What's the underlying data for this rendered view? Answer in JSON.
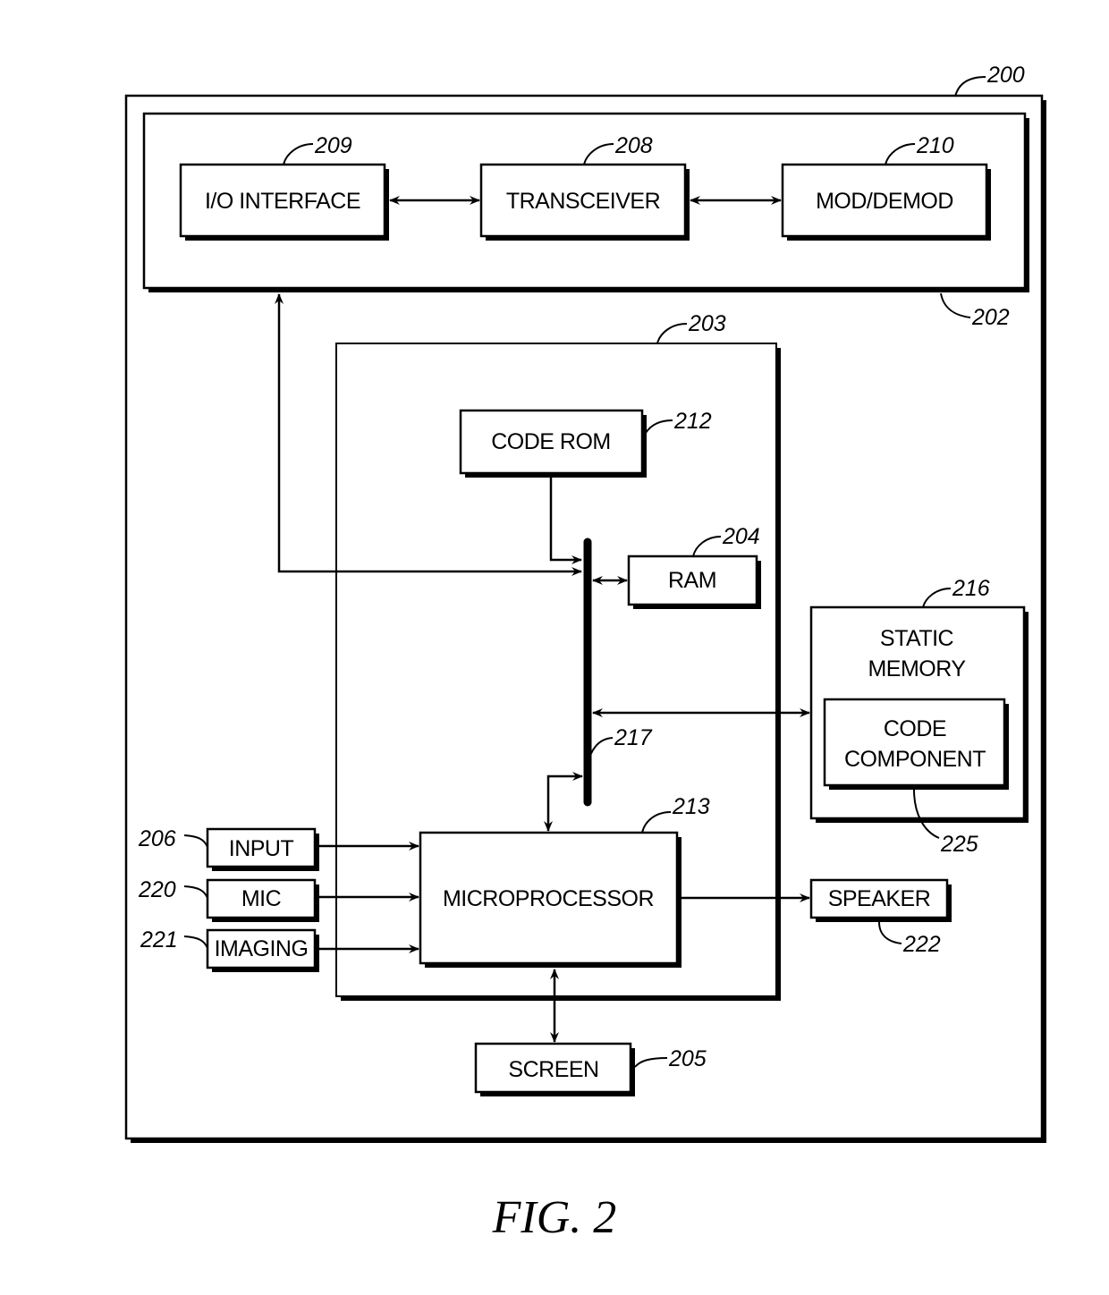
{
  "figure": {
    "caption": "FIG. 2",
    "refs": {
      "device": "200",
      "comm_unit": "202",
      "processing_unit": "203",
      "io_interface": "209",
      "transceiver": "208",
      "mod_demod": "210",
      "code_rom": "212",
      "ram": "204",
      "static_memory": "216",
      "code_component": "225",
      "bus": "217",
      "microprocessor": "213",
      "input": "206",
      "mic": "220",
      "imaging": "221",
      "speaker": "222",
      "screen": "205"
    },
    "labels": {
      "io_interface": "I/O INTERFACE",
      "transceiver": "TRANSCEIVER",
      "mod_demod": "MOD/DEMOD",
      "code_rom": "CODE ROM",
      "ram": "RAM",
      "static_memory_line1": "STATIC",
      "static_memory_line2": "MEMORY",
      "code_component_line1": "CODE",
      "code_component_line2": "COMPONENT",
      "microprocessor": "MICROPROCESSOR",
      "input": "INPUT",
      "mic": "MIC",
      "imaging": "IMAGING",
      "speaker": "SPEAKER",
      "screen": "SCREEN"
    }
  }
}
